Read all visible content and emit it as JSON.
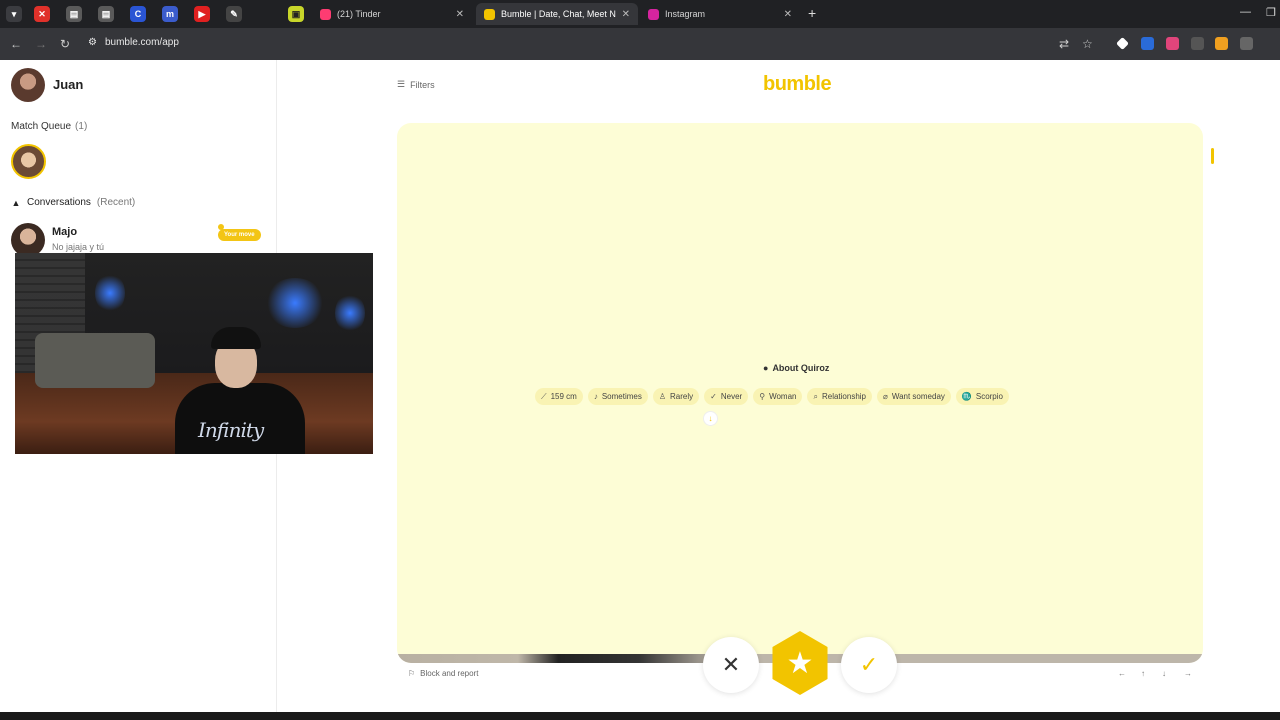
{
  "browser": {
    "tabs": [
      {
        "label": "(21) Tinder",
        "fav_color": "#fe3c72"
      },
      {
        "label": "Bumble | Date, Chat, Meet Nev",
        "fav_color": "#f2c400"
      },
      {
        "label": "Instagram",
        "fav_color": "#d6249f"
      }
    ],
    "url": "bumble.com/app"
  },
  "sidebar": {
    "user_name": "Juan",
    "match_queue_label": "Match Queue",
    "match_queue_count": "(1)",
    "conversations_label": "Conversations",
    "conversations_sub": "(Recent)",
    "chats": [
      {
        "name": "Majo",
        "message": "No jajaja y tú",
        "badge": "Your move"
      }
    ]
  },
  "main": {
    "filters_label": "Filters",
    "logo": "bumble",
    "about_title": "About Quiroz",
    "chips": [
      {
        "icon": "ruler-icon",
        "glyph": "⟋",
        "label": "159 cm"
      },
      {
        "icon": "drink-icon",
        "glyph": "♪",
        "label": "Sometimes"
      },
      {
        "icon": "smoke-icon",
        "glyph": "♙",
        "label": "Rarely"
      },
      {
        "icon": "cannabis-icon",
        "glyph": "✓",
        "label": "Never"
      },
      {
        "icon": "gender-icon",
        "glyph": "⚲",
        "label": "Woman"
      },
      {
        "icon": "search-icon",
        "glyph": "⌕",
        "label": "Relationship"
      },
      {
        "icon": "tag-icon",
        "glyph": "⌀",
        "label": "Want someday"
      },
      {
        "icon": "zodiac-icon",
        "glyph": "♏",
        "label": "Scorpio"
      }
    ],
    "block_report": "Block and report",
    "nav_keys": [
      "←",
      "↑",
      "↓",
      "→"
    ]
  },
  "colors": {
    "accent": "#f2c400",
    "card_bg": "#fdfdd6"
  }
}
